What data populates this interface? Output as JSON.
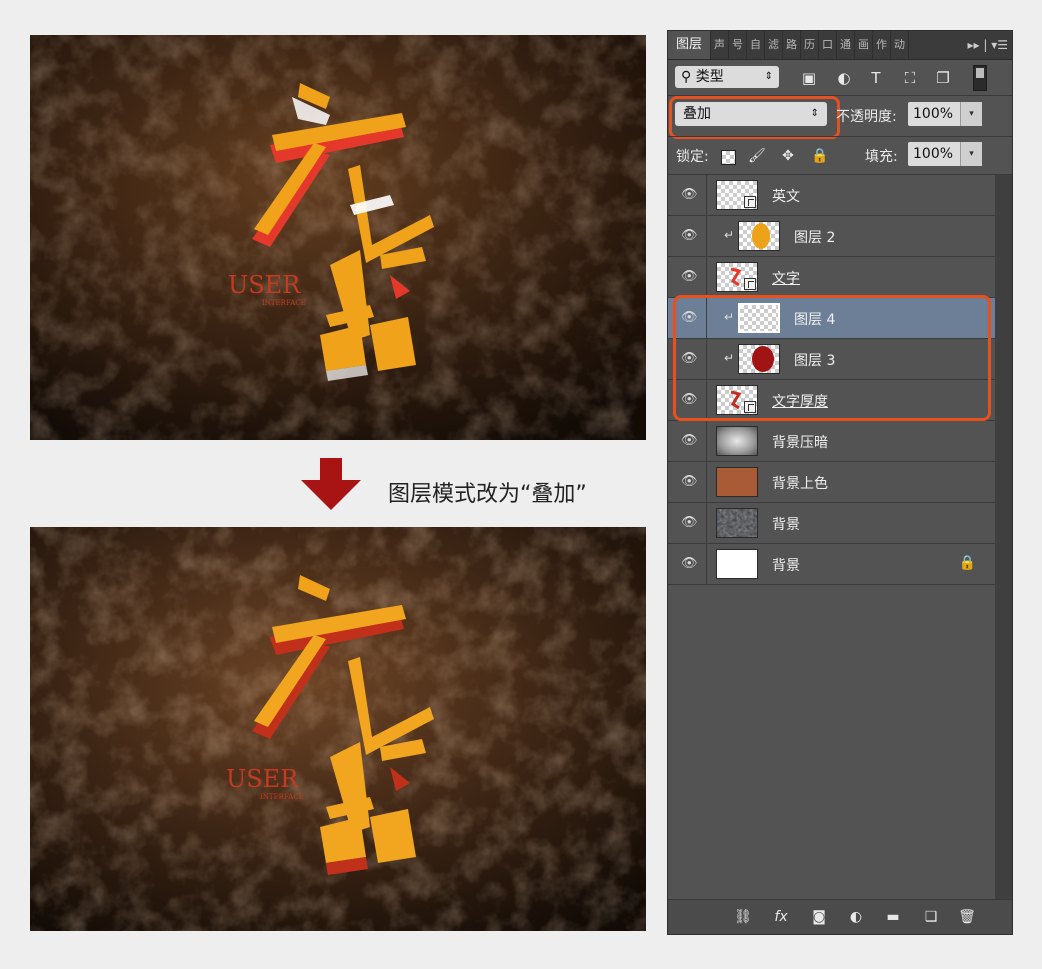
{
  "caption": "图层模式改为“叠加”",
  "panel": {
    "tabs": [
      {
        "label": "图层",
        "active": true
      },
      {
        "label": "声"
      },
      {
        "label": "号"
      },
      {
        "label": "自"
      },
      {
        "label": "滤"
      },
      {
        "label": "路"
      },
      {
        "label": "历"
      },
      {
        "label": "口"
      },
      {
        "label": "通"
      },
      {
        "label": "画"
      },
      {
        "label": "作"
      },
      {
        "label": "动"
      }
    ],
    "tab_icons": "▸▸ | ▾☰",
    "filter": {
      "label": "类型",
      "icon": "search-icon"
    },
    "blend_mode": "叠加",
    "opacity_label": "不透明度:",
    "opacity_value": "100%",
    "lock_label": "锁定:",
    "fill_label": "填充:",
    "fill_value": "100%",
    "highlight_color": "#e8501e",
    "layers": [
      {
        "name": "英文",
        "thumb": "checker-smart",
        "clipped": false,
        "underline": false,
        "selected": false
      },
      {
        "name": "图层 2",
        "thumb": "orange-blob",
        "clipped": true,
        "underline": false,
        "selected": false
      },
      {
        "name": "文字",
        "thumb": "text-smart",
        "clipped": false,
        "underline": true,
        "selected": false
      },
      {
        "name": "图层 4",
        "thumb": "checker",
        "clipped": true,
        "underline": false,
        "selected": true
      },
      {
        "name": "图层 3",
        "thumb": "red-blob",
        "clipped": true,
        "underline": false,
        "selected": false
      },
      {
        "name": "文字厚度",
        "thumb": "text-smart",
        "clipped": false,
        "underline": true,
        "selected": false
      },
      {
        "name": "背景压暗",
        "thumb": "radial",
        "clipped": false,
        "underline": false,
        "selected": false
      },
      {
        "name": "背景上色",
        "thumb": "brown",
        "clipped": false,
        "underline": false,
        "selected": false
      },
      {
        "name": "背景",
        "thumb": "rock",
        "clipped": false,
        "underline": false,
        "selected": false
      },
      {
        "name": "背景",
        "thumb": "white",
        "clipped": false,
        "underline": false,
        "selected": false,
        "locked": true
      }
    ]
  },
  "artwork": {
    "en_text": "USER",
    "en_sub": "INTERFACE",
    "accent": "#f0a21a",
    "arrow_color": "#a81313"
  }
}
